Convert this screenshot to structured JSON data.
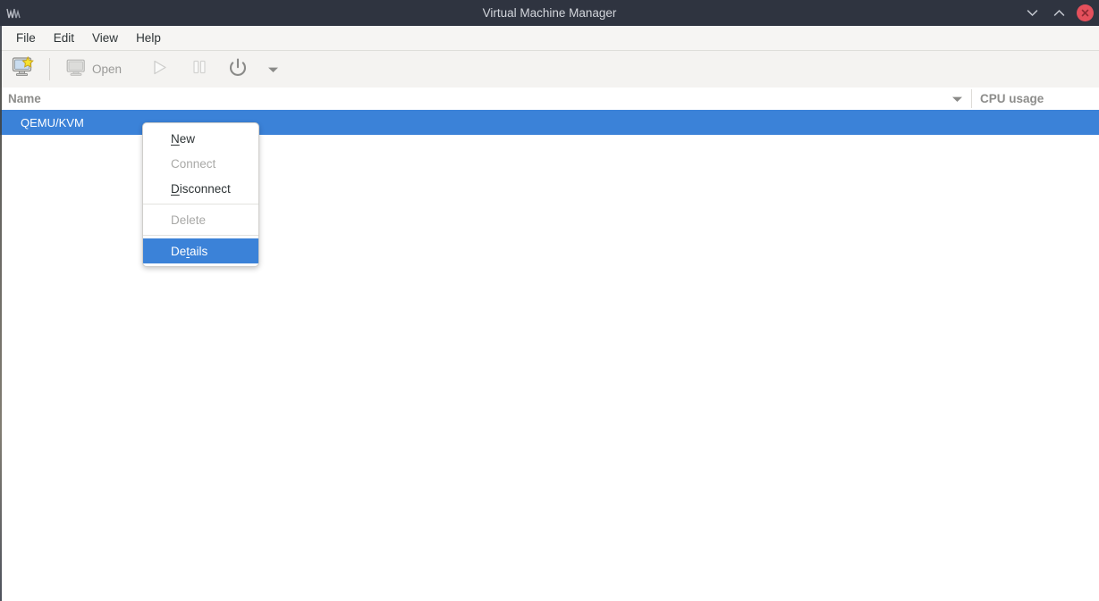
{
  "window": {
    "title": "Virtual Machine Manager",
    "app_icon": "vmm-logo-icon",
    "controls": {
      "minimize": "minimize-icon",
      "maximize": "maximize-icon",
      "close": "close-icon"
    },
    "colors": {
      "titlebar_bg": "#2f3440",
      "titlebar_fg": "#d3d6dc",
      "close_btn": "#e4505c",
      "accent_blue": "#3b82d8",
      "toolbar_bg": "#f4f3f1",
      "menubar_bg": "#f6f5f3"
    }
  },
  "menubar": {
    "items": [
      {
        "label": "File"
      },
      {
        "label": "Edit"
      },
      {
        "label": "View"
      },
      {
        "label": "Help"
      }
    ]
  },
  "toolbar": {
    "new_vm": {
      "icon": "new-vm-monitor-star-icon",
      "enabled": true
    },
    "open": {
      "label": "Open",
      "icon": "monitor-icon",
      "enabled": false
    },
    "run": {
      "icon": "play-icon",
      "enabled": false
    },
    "pause": {
      "icon": "pause-icon",
      "enabled": false
    },
    "shutdown": {
      "icon": "power-icon",
      "enabled": false
    },
    "shutdown_menu": {
      "icon": "caret-down-icon",
      "enabled": true
    }
  },
  "list": {
    "columns": [
      {
        "key": "name",
        "label": "Name",
        "sort_indicator": "sort-descending-icon"
      },
      {
        "key": "cpu",
        "label": "CPU usage"
      }
    ],
    "rows": [
      {
        "name": "QEMU/KVM",
        "cpu": "",
        "selected": true
      }
    ]
  },
  "context_menu": {
    "items": [
      {
        "label": "New",
        "mnemonic": "N",
        "prefix": "",
        "suffix": "ew",
        "enabled": true,
        "highlighted": false,
        "separator_before": false
      },
      {
        "label": "Connect",
        "mnemonic": "",
        "prefix": "Connect",
        "suffix": "",
        "enabled": false,
        "highlighted": false,
        "separator_before": false
      },
      {
        "label": "Disconnect",
        "mnemonic": "D",
        "prefix": "",
        "suffix": "isconnect",
        "enabled": true,
        "highlighted": false,
        "separator_before": false
      },
      {
        "label": "Delete",
        "mnemonic": "",
        "prefix": "Delete",
        "suffix": "",
        "enabled": false,
        "highlighted": false,
        "separator_before": true
      },
      {
        "label": "Details",
        "mnemonic": "t",
        "prefix": "De",
        "suffix": "ails",
        "enabled": true,
        "highlighted": true,
        "separator_before": true
      }
    ]
  }
}
